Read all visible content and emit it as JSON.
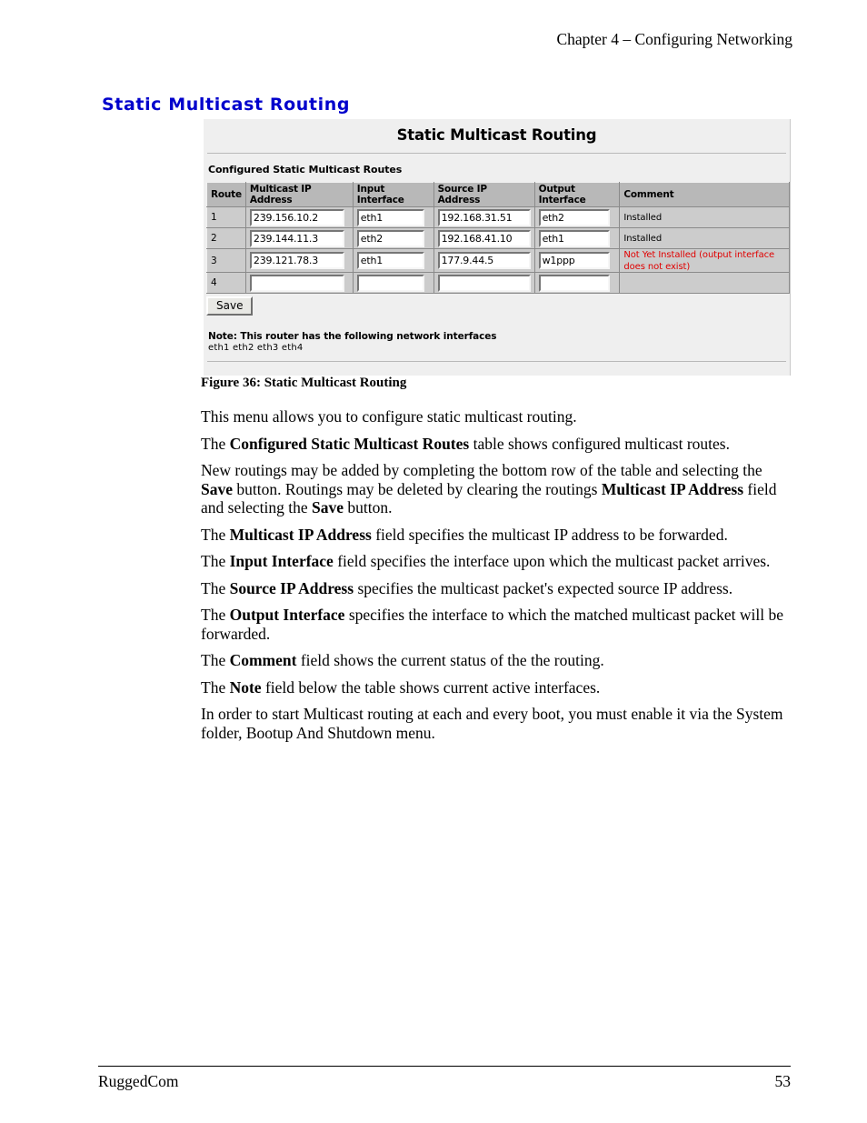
{
  "page": {
    "running_header": "Chapter 4 – Configuring Networking",
    "heading": "Static Multicast Routing",
    "figure_caption": "Figure 36: Static Multicast Routing",
    "footer_left": "RuggedCom",
    "footer_right": "53",
    "heading_color": "#0000cc"
  },
  "screenshot": {
    "title": "Static Multicast Routing",
    "subtitle": "Configured Static Multicast Routes",
    "table": {
      "headers": [
        "Route",
        "Multicast IP Address",
        "Input Interface",
        "Source IP Address",
        "Output Interface",
        "Comment"
      ],
      "rows": [
        {
          "route": "1",
          "multicast_ip": "239.156.10.2",
          "input_interface": "eth1",
          "source_ip": "192.168.31.51",
          "output_interface": "eth2",
          "comment": "Installed",
          "comment_status": "ok"
        },
        {
          "route": "2",
          "multicast_ip": "239.144.11.3",
          "input_interface": "eth2",
          "source_ip": "192.168.41.10",
          "output_interface": "eth1",
          "comment": "Installed",
          "comment_status": "ok"
        },
        {
          "route": "3",
          "multicast_ip": "239.121.78.3",
          "input_interface": "eth1",
          "source_ip": "177.9.44.5",
          "output_interface": "w1ppp",
          "comment": "Not Yet Installed (output interface does not exist)",
          "comment_status": "warning"
        },
        {
          "route": "4",
          "multicast_ip": "",
          "input_interface": "",
          "source_ip": "",
          "output_interface": "",
          "comment": "",
          "comment_status": "empty"
        }
      ]
    },
    "save_label": "Save",
    "note_title": "Note: This router has the following network interfaces",
    "note_body": "eth1 eth2 eth3 eth4",
    "warning_color": "#e00000"
  },
  "body": {
    "p1": "This menu allows you to configure static multicast routing.",
    "p2_a": "The ",
    "p2_b1": "Configured Static Multicast Routes",
    "p2_c": " table shows configured multicast routes.",
    "p3_a": "New routings may be added by completing the bottom row of the table and selecting the ",
    "p3_b1": "Save",
    "p3_c": " button.  Routings may be deleted by clearing the routings ",
    "p3_b2": "Multicast IP Address",
    "p3_d": " field and selecting the ",
    "p3_b3": "Save",
    "p3_e": " button.",
    "p4_a": "The ",
    "p4_b1": "Multicast IP Address",
    "p4_c": " field specifies the multicast IP address to be forwarded.",
    "p5_a": "The ",
    "p5_b1": "Input Interface",
    "p5_c": " field specifies the interface upon which the multicast packet arrives.",
    "p6_a": "The ",
    "p6_b1": "Source IP Address",
    "p6_c": " specifies the multicast packet's expected source IP address.",
    "p7_a": "The ",
    "p7_b1": "Output Interface",
    "p7_c": " specifies the interface to which the matched multicast packet will be forwarded.",
    "p8_a": "The ",
    "p8_b1": "Comment",
    "p8_c": " field shows the current status of the the routing.",
    "p9_a": "The ",
    "p9_b1": "Note",
    "p9_c": " field below the table shows current active interfaces.",
    "p10": "In order to start Multicast routing at each and every boot, you must enable it via the System folder, Bootup And Shutdown menu."
  }
}
